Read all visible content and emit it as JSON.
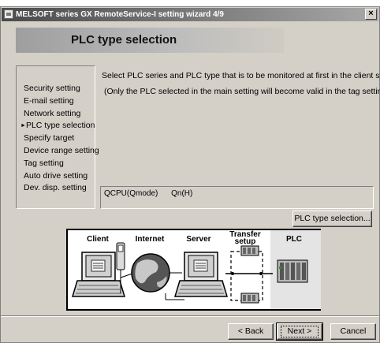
{
  "window": {
    "title": "MELSOFT series GX RemoteService-I setting wizard 4/9",
    "close_symbol": "×"
  },
  "banner": {
    "title": "PLC type selection"
  },
  "steps": [
    {
      "label": "Security setting",
      "current": false
    },
    {
      "label": "E-mail setting",
      "current": false
    },
    {
      "label": "Network setting",
      "current": false
    },
    {
      "label": "PLC type selection",
      "current": true
    },
    {
      "label": "Specify target",
      "current": false
    },
    {
      "label": "Device range setting",
      "current": false
    },
    {
      "label": "Tag setting",
      "current": false
    },
    {
      "label": "Auto drive setting",
      "current": false
    },
    {
      "label": "Dev. disp. setting",
      "current": false
    }
  ],
  "current_marker": "►",
  "description": {
    "line1": "Select PLC series and PLC type that is to be monitored at first in the client side.",
    "line2": "(Only the PLC selected in the main setting will become valid in the tag setting.)"
  },
  "selection": {
    "model": "QCPU(Qmode)",
    "type": "Qn(H)"
  },
  "buttons": {
    "plc_type_selection": "PLC type selection...",
    "back": "< Back",
    "next": "Next >",
    "cancel": "Cancel"
  },
  "diagram": {
    "labels": {
      "client": "Client",
      "internet": "Internet",
      "server": "Server",
      "transfer_setup_1": "Transfer",
      "transfer_setup_2": "setup",
      "plc": "PLC"
    },
    "highlighted_stage": "PLC"
  }
}
